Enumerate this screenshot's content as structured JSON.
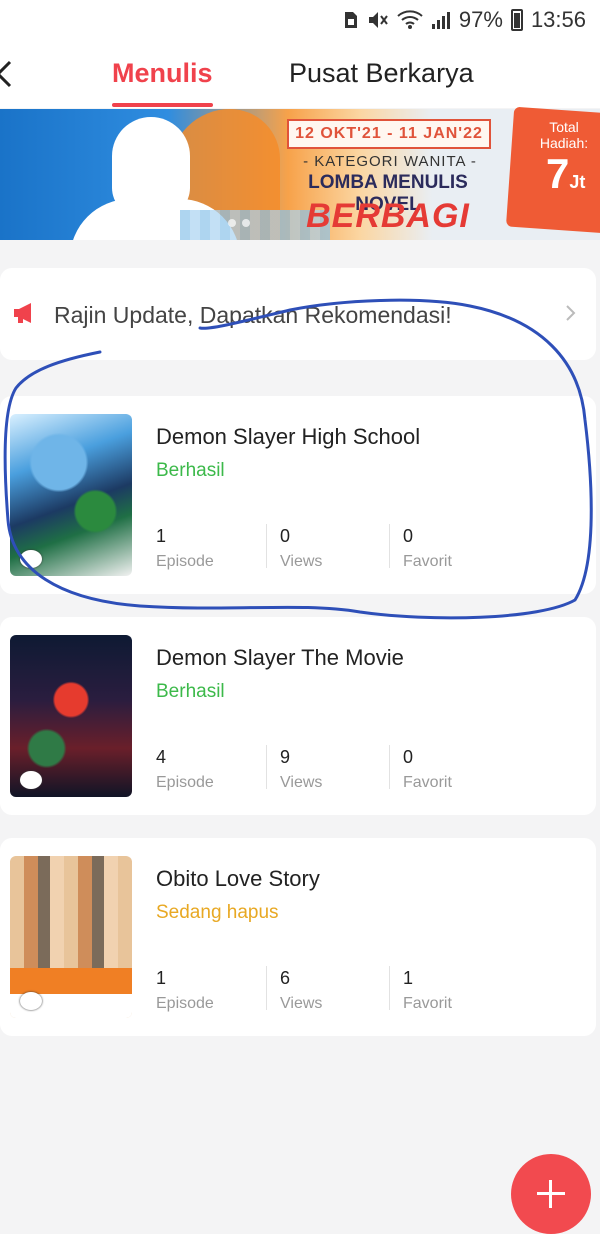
{
  "status_bar": {
    "battery": "97%",
    "time": "13:56"
  },
  "header": {
    "tabs": [
      {
        "label": "Menulis",
        "active": true
      },
      {
        "label": "Pusat Berkarya",
        "active": false
      }
    ]
  },
  "banner": {
    "dates": "12 OKT'21 - 11 JAN'22",
    "category": "- KATEGORI WANITA -",
    "headline": "LOMBA MENULIS NOVEL",
    "theme": "BERBAGI CINTA",
    "prize_label": "Total Hadiah:",
    "prize_amount": "7",
    "prize_unit": "Jt"
  },
  "notice": {
    "text": "Rajin Update, Dapatkan Rekomendasi!"
  },
  "works": [
    {
      "title": "Demon Slayer High School",
      "status": "Berhasil",
      "episodes": "1",
      "views": "0",
      "favorites": "0"
    },
    {
      "title": "Demon Slayer The Movie",
      "status": "Berhasil",
      "episodes": "4",
      "views": "9",
      "favorites": "0"
    },
    {
      "title": "Obito Love Story",
      "status": "Sedang hapus",
      "episodes": "1",
      "views": "6",
      "favorites": "1"
    }
  ],
  "labels": {
    "episode": "Episode",
    "views": "Views",
    "favorit": "Favorit"
  },
  "colors": {
    "accent": "#f0424c",
    "success": "#3cb94a",
    "warning": "#e8a823",
    "annotation": "#2e4fb8"
  }
}
